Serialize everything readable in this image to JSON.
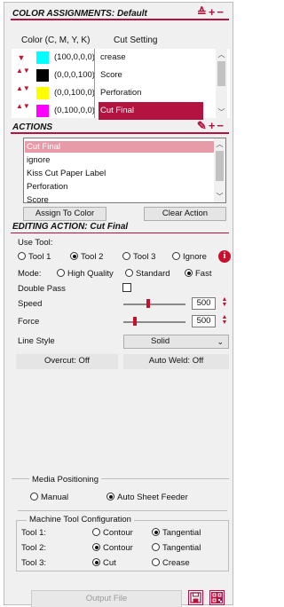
{
  "color_assignments": {
    "title": "COLOR ASSIGNMENTS: Default",
    "header_actions": "≙+−",
    "col_color": "Color (C, M, Y, K)",
    "col_cut": "Cut Setting",
    "rows": [
      {
        "swatch": "#00ffff",
        "value": "(100,0,0,0)",
        "cut": "crease",
        "arrow": "▼"
      },
      {
        "swatch": "#000000",
        "value": "(0,0,0,100)",
        "cut": "Score",
        "arrow": "▲▼"
      },
      {
        "swatch": "#ffff00",
        "value": "(0,0,100,0)",
        "cut": "Perforation",
        "arrow": "▲▼"
      },
      {
        "swatch": "#ff00ff",
        "value": "(0,100,0,0)",
        "cut": "Cut Final",
        "arrow": "▲▼"
      }
    ]
  },
  "actions": {
    "title": "ACTIONS",
    "header_actions": "✎+−",
    "items": [
      "Cut Final",
      "ignore",
      "Kiss Cut Paper Label",
      "Perforation",
      "Score"
    ],
    "assign_button": "Assign To Color",
    "clear_button": "Clear Action"
  },
  "editing": {
    "title": "EDITING ACTION: Cut Final",
    "use_tool_label": "Use Tool:",
    "tools": [
      "Tool 1",
      "Tool 2",
      "Tool 3",
      "Ignore"
    ],
    "tool_selected": "Tool 2",
    "mode_label": "Mode:",
    "modes": [
      "High Quality",
      "Standard",
      "Fast"
    ],
    "mode_selected": "Fast",
    "double_pass_label": "Double Pass",
    "double_pass_checked": false,
    "speed_label": "Speed",
    "speed_value": "500",
    "force_label": "Force",
    "force_value": "500",
    "line_style_label": "Line Style",
    "line_style_value": "Solid",
    "overcut_button": "Overcut: Off",
    "autoweld_button": "Auto Weld: Off"
  },
  "media": {
    "title": "Media Positioning",
    "options": [
      "Manual",
      "Auto Sheet Feeder"
    ],
    "selected": "Auto Sheet Feeder"
  },
  "machine": {
    "title": "Machine Tool Configuration",
    "rows": [
      {
        "label": "Tool 1:",
        "opt1": "Contour",
        "opt2": "Tangential",
        "selected": 2
      },
      {
        "label": "Tool 2:",
        "opt1": "Contour",
        "opt2": "Tangential",
        "selected": 1
      },
      {
        "label": "Tool 3:",
        "opt1": "Cut",
        "opt2": "Crease",
        "selected": 1
      }
    ]
  },
  "footer": {
    "output_button": "Output File"
  },
  "colors": {
    "accent": "#b31340",
    "accent_light": "#e79aa7",
    "arrow_red": "#c8102e"
  }
}
